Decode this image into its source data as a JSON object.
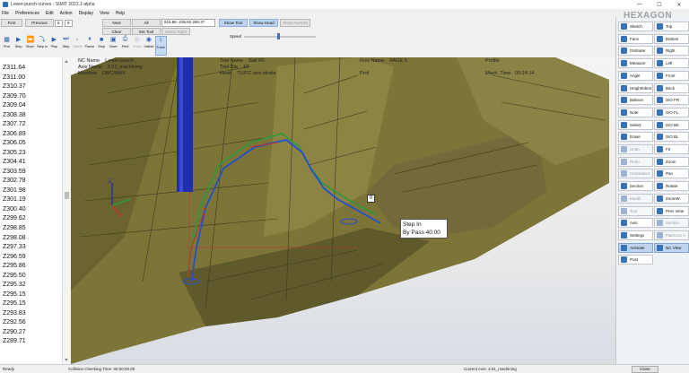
{
  "window": {
    "title": "Lower-punch-curves - SIMIT 2023.1-alpha",
    "minimize": "—",
    "maximize": "☐",
    "close": "✕"
  },
  "menu": [
    "File",
    "Preferences",
    "Edit",
    "Action",
    "Display",
    "View",
    "Help"
  ],
  "toolbar": {
    "first": "First",
    "previous": "Previous",
    "step_value": "6",
    "step_total": "8",
    "next": "Next",
    "last": "Last",
    "all": "All",
    "coords": "615.86 -235.82 280.27",
    "show_tool": "Show Tool",
    "show_head": "Show Head",
    "show_axes": "Show Axes/Hi",
    "clear": "Clear",
    "set_tool": "Set Tool",
    "select_right": "Select Right",
    "speed_label": "Speed",
    "speed_level": 0.47
  },
  "tools": [
    {
      "label": "Prof",
      "icon": "profile-icon",
      "state": "normal"
    },
    {
      "label": "Step",
      "icon": "step-icon",
      "state": "normal"
    },
    {
      "label": "Step+",
      "icon": "step-plus-icon",
      "state": "normal"
    },
    {
      "label": "Step In",
      "icon": "step-in-icon",
      "state": "normal"
    },
    {
      "label": "Play",
      "icon": "play-icon",
      "state": "normal"
    },
    {
      "label": "Step",
      "icon": "step-forward-icon",
      "state": "normal"
    },
    {
      "label": "Stroke",
      "icon": "stroke-icon",
      "state": "disabled"
    },
    {
      "label": "Pause",
      "icon": "pause-icon",
      "state": "normal"
    },
    {
      "label": "Stop",
      "icon": "stop-icon",
      "state": "normal"
    },
    {
      "label": "Save",
      "icon": "save-icon",
      "state": "normal"
    },
    {
      "label": "Print",
      "icon": "print-icon",
      "state": "normal"
    },
    {
      "label": "Show",
      "icon": "show-icon",
      "state": "disabled"
    },
    {
      "label": "Visible",
      "icon": "visible-icon",
      "state": "normal"
    },
    {
      "label": "Trace",
      "icon": "trace-icon",
      "state": "active"
    }
  ],
  "z_values": [
    "Z311.64",
    "Z311.00",
    "Z310.37",
    "Z309.70",
    "Z309.04",
    "Z308.38",
    "Z307.72",
    "Z306.89",
    "Z306.05",
    "Z305.23",
    "Z304.41",
    "Z303.59",
    "Z302.78",
    "Z301.98",
    "Z301.19",
    "Z300.40",
    "Z299.62",
    "Z298.85",
    "Z298.08",
    "Z297.33",
    "Z296.59",
    "Z295.86",
    "Z295.50",
    "Z295.32",
    "Z295.15",
    "Z295.15",
    "Z293.83",
    "Z292.56",
    "Z290.27",
    "Z289.71"
  ],
  "viewport_info": {
    "nc_name_label": "NC Name",
    "nc_name_value": "Lower-punch",
    "axis_name_label": "Axis Name",
    "axis_name_value": "3.01_machining",
    "machine_label": "Machine",
    "machine_value": "DMC/MAX",
    "tool_name_label": "Tool Name",
    "tool_name_value": "Ball R5",
    "tool_dia_label": "Tool Dia",
    "tool_dia_value": "10",
    "head_label": "Head",
    "head_value": "TU/FC and stroke",
    "row_name_label": "Row Name",
    "row_name_value": "PAGE 6",
    "prof_label": "Prof",
    "profile_label": "Profile",
    "mach_time_label": "Mach. Time",
    "mach_time_value": "00:24:14",
    "step_popup_line1": "Step In",
    "step_popup_line2": "By Pass 40.00",
    "marker_zero": "0"
  },
  "right_panel": {
    "brand": "HEXAGON",
    "left_col": [
      {
        "label": "Sketch",
        "icon": "sketch-icon",
        "state": "normal",
        "color": "#3a72b8"
      },
      {
        "label": "Face",
        "icon": "face-icon",
        "state": "normal",
        "color": "#3a72b8"
      },
      {
        "label": "Ordinate",
        "icon": "ordinate-icon",
        "state": "normal",
        "color": "#3a72b8"
      },
      {
        "label": "Measure",
        "icon": "measure-icon",
        "state": "normal",
        "color": "#3a72b8"
      },
      {
        "label": "Angle",
        "icon": "angle-icon",
        "state": "normal",
        "color": "#3a72b8"
      },
      {
        "label": "Height/Ident",
        "icon": "height-icon",
        "state": "normal",
        "color": "#3a72b8"
      },
      {
        "label": "Balloon",
        "icon": "balloon-icon",
        "state": "normal",
        "color": "#3a72b8"
      },
      {
        "label": "Note",
        "icon": "note-icon",
        "state": "normal",
        "color": "#3a72b8"
      },
      {
        "label": "Select",
        "icon": "select-icon",
        "state": "normal",
        "color": "#3a72b8"
      },
      {
        "label": "Erase",
        "icon": "erase-icon",
        "state": "normal",
        "color": "#3a72b8"
      },
      {
        "label": "Undo",
        "icon": "undo-icon",
        "state": "disabled",
        "color": "#9cb4d4"
      },
      {
        "label": "Redo",
        "icon": "redo-icon",
        "state": "disabled",
        "color": "#9cb4d4"
      },
      {
        "label": "Orientation",
        "icon": "orientation-icon",
        "state": "disabled",
        "color": "#9cb4d4"
      },
      {
        "label": "Section",
        "icon": "section-icon",
        "state": "normal",
        "color": "#3a72b8"
      },
      {
        "label": "Model",
        "icon": "model-icon",
        "state": "disabled",
        "color": "#9cb4d4"
      },
      {
        "label": "Tool",
        "icon": "tool-icon",
        "state": "disabled",
        "color": "#9cb4d4"
      },
      {
        "label": "Axis",
        "icon": "axis-icon",
        "state": "normal",
        "color": "#3a72b8"
      },
      {
        "label": "Settings",
        "icon": "settings-icon",
        "state": "normal",
        "color": "#3a72b8"
      },
      {
        "label": "Animate",
        "icon": "animate-icon",
        "state": "active",
        "color": "#3a72b8"
      },
      {
        "label": "Post",
        "icon": "post-icon",
        "state": "normal",
        "color": "#3a72b8"
      }
    ],
    "right_col": [
      {
        "label": "Top",
        "icon": "top-view-icon",
        "state": "normal",
        "color": "#3a72b8"
      },
      {
        "label": "Bottom",
        "icon": "bottom-view-icon",
        "state": "normal",
        "color": "#3a72b8"
      },
      {
        "label": "Right",
        "icon": "right-view-icon",
        "state": "normal",
        "color": "#3a72b8"
      },
      {
        "label": "Left",
        "icon": "left-view-icon",
        "state": "normal",
        "color": "#3a72b8"
      },
      {
        "label": "Front",
        "icon": "front-view-icon",
        "state": "normal",
        "color": "#3a72b8"
      },
      {
        "label": "Back",
        "icon": "back-view-icon",
        "state": "normal",
        "color": "#3a72b8"
      },
      {
        "label": "ISO FR",
        "icon": "iso-fr-icon",
        "state": "normal",
        "color": "#3a72b8"
      },
      {
        "label": "ISO FL",
        "icon": "iso-fl-icon",
        "state": "normal",
        "color": "#3a72b8"
      },
      {
        "label": "ISO BK",
        "icon": "iso-bk-icon",
        "state": "normal",
        "color": "#3a72b8"
      },
      {
        "label": "ISO BL",
        "icon": "iso-bl-icon",
        "state": "normal",
        "color": "#3a72b8"
      },
      {
        "label": "Fit",
        "icon": "fit-icon",
        "state": "normal",
        "color": "#3a72b8"
      },
      {
        "label": "Zoom",
        "icon": "zoom-icon",
        "state": "normal",
        "color": "#3a72b8"
      },
      {
        "label": "Pan",
        "icon": "pan-icon",
        "state": "normal",
        "color": "#3a72b8"
      },
      {
        "label": "Rotate",
        "icon": "rotate-icon",
        "state": "normal",
        "color": "#3a72b8"
      },
      {
        "label": "ZoomW",
        "icon": "zoom-window-icon",
        "state": "normal",
        "color": "#3a72b8"
      },
      {
        "label": "Prev View",
        "icon": "prev-view-icon",
        "state": "normal",
        "color": "#3a72b8"
      },
      {
        "label": "Section",
        "icon": "section-view-icon",
        "state": "disabled",
        "color": "#9cb4d4"
      },
      {
        "label": "Flat/Curv A",
        "icon": "flat-curve-icon",
        "state": "disabled",
        "color": "#9cb4d4"
      },
      {
        "label": "NC View",
        "icon": "nc-view-icon",
        "state": "active",
        "color": "#3a72b8"
      }
    ]
  },
  "status": {
    "ready": "Ready",
    "collision": "Collision Checking Time: 00:00:00.00",
    "current_axis": "Current Axis: 3.01_machining",
    "close_btn": "Close"
  },
  "colors": {
    "part": "#7d7438",
    "part_dark": "#55502a",
    "tool": "#1f2fa8",
    "toolpath": "#2050d0",
    "green_path": "#2a9a3a",
    "red_path": "#c23030"
  }
}
